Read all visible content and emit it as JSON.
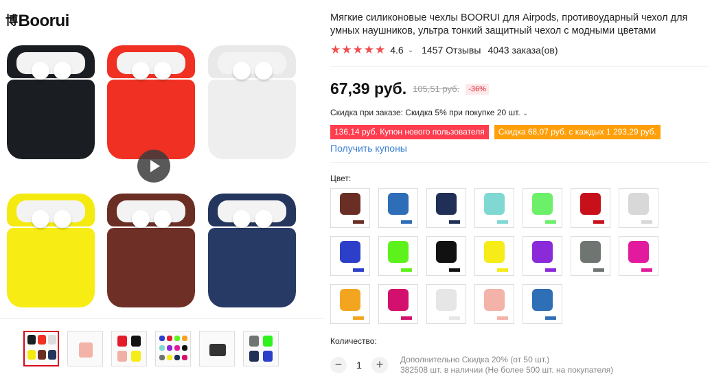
{
  "brand": {
    "glyph": "博",
    "name": "Boorui"
  },
  "product": {
    "title": "Мягкие силиконовые чехлы BOORUI для Airpods, противоударный чехол для умных наушников, ультра тонкий защитный чехол с модными цветами",
    "rating": "4.6",
    "reviews": "1457 Отзывы",
    "orders": "4043 заказа(ов)"
  },
  "price": {
    "current": "67,39 руб.",
    "old": "105,51 руб.",
    "discount": "-36%"
  },
  "bulk_discount": "Скидка при заказе: Скидка 5% при покупке 20 шт.",
  "coupons": [
    {
      "label": "136,14 руб. Купон нового пользователя",
      "color": "#fe3d4f"
    },
    {
      "label": "Скидка 68,07 руб. с каждых 1 293,29 руб.",
      "color": "#ff9f09"
    }
  ],
  "get_coupons": "Получить купоны",
  "color_label": "Цвет:",
  "colors": [
    {
      "name": "coffee",
      "hex": "#6b2e24"
    },
    {
      "name": "gradient-blue",
      "hex": "#2e6db8"
    },
    {
      "name": "navy",
      "hex": "#1f2f55"
    },
    {
      "name": "mint",
      "hex": "#7fd9d2"
    },
    {
      "name": "glow",
      "hex": "#6cf06a"
    },
    {
      "name": "red",
      "hex": "#c8101a"
    },
    {
      "name": "gray-white",
      "hex": "#d8d8d8"
    },
    {
      "name": "blue",
      "hex": "#2b3fc9"
    },
    {
      "name": "green",
      "hex": "#5ef21c"
    },
    {
      "name": "black",
      "hex": "#111111"
    },
    {
      "name": "yellow",
      "hex": "#f6ec18"
    },
    {
      "name": "purple",
      "hex": "#8a2ad8"
    },
    {
      "name": "dark-gray",
      "hex": "#6f7672"
    },
    {
      "name": "pink",
      "hex": "#e21b9e"
    },
    {
      "name": "orange",
      "hex": "#f3a51f"
    },
    {
      "name": "rose",
      "hex": "#d3106e"
    },
    {
      "name": "white",
      "hex": "#e6e6e6"
    },
    {
      "name": "peach",
      "hex": "#f4b3a8"
    },
    {
      "name": "ocean",
      "hex": "#2f6fb5"
    }
  ],
  "quantity": {
    "label": "Количество:",
    "value": "1",
    "minus": "−",
    "plus": "+",
    "extra_discount": "Дополнительно Скидка 20% (от 50 шт.)",
    "stock": "382508 шт. в наличии (Не более 500 шт. на покупателя)"
  },
  "icons": {
    "play": "play-icon",
    "chevron": "chevron-down-icon",
    "star": "star-icon"
  }
}
